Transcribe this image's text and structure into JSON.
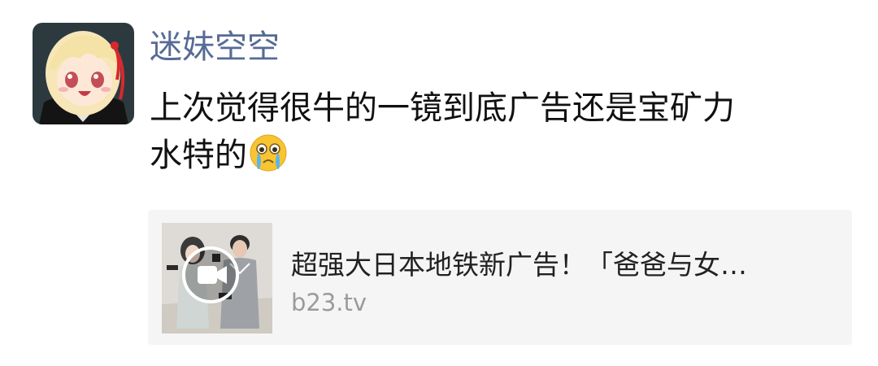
{
  "post": {
    "username": "迷妹空空",
    "text_line1": "上次觉得很牛的一镜到底广告还是宝矿力",
    "text_line2": "水特的",
    "emoji": "crying-emoji"
  },
  "link_card": {
    "title": "超强大日本地铁新广告！「爸爸与女…",
    "domain": "b23.tv",
    "thumbnail_icon": "play-icon"
  },
  "colors": {
    "username": "#576b95",
    "text": "#111111",
    "card_bg": "#f5f5f5",
    "domain": "#9b9b9b"
  }
}
